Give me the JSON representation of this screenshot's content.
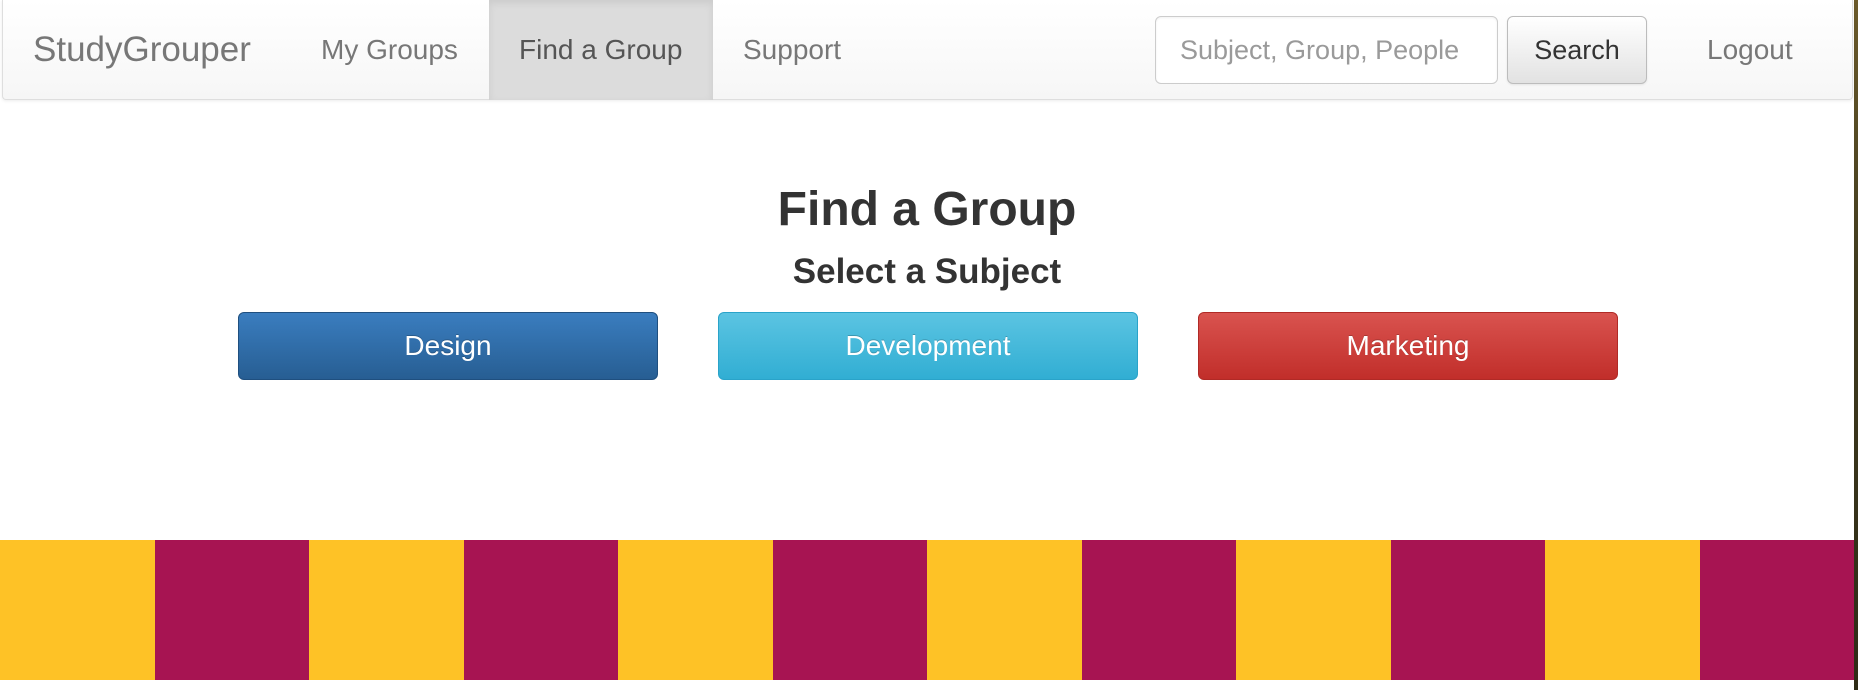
{
  "navbar": {
    "brand": "StudyGrouper",
    "items": [
      {
        "label": "My Groups",
        "active": false
      },
      {
        "label": "Find a Group",
        "active": true
      },
      {
        "label": "Support",
        "active": false
      }
    ],
    "search": {
      "placeholder": "Subject, Group, People",
      "value": "",
      "button_label": "Search"
    },
    "logout_label": "Logout"
  },
  "main": {
    "title": "Find a Group",
    "subtitle": "Select a Subject",
    "subjects": [
      {
        "label": "Design",
        "color": "#2f6da8"
      },
      {
        "label": "Development",
        "color": "#46b8da"
      },
      {
        "label": "Marketing",
        "color": "#d43f3a"
      }
    ]
  },
  "banner": {
    "colors": [
      "#fec226",
      "#a71452"
    ],
    "cells": 12
  }
}
